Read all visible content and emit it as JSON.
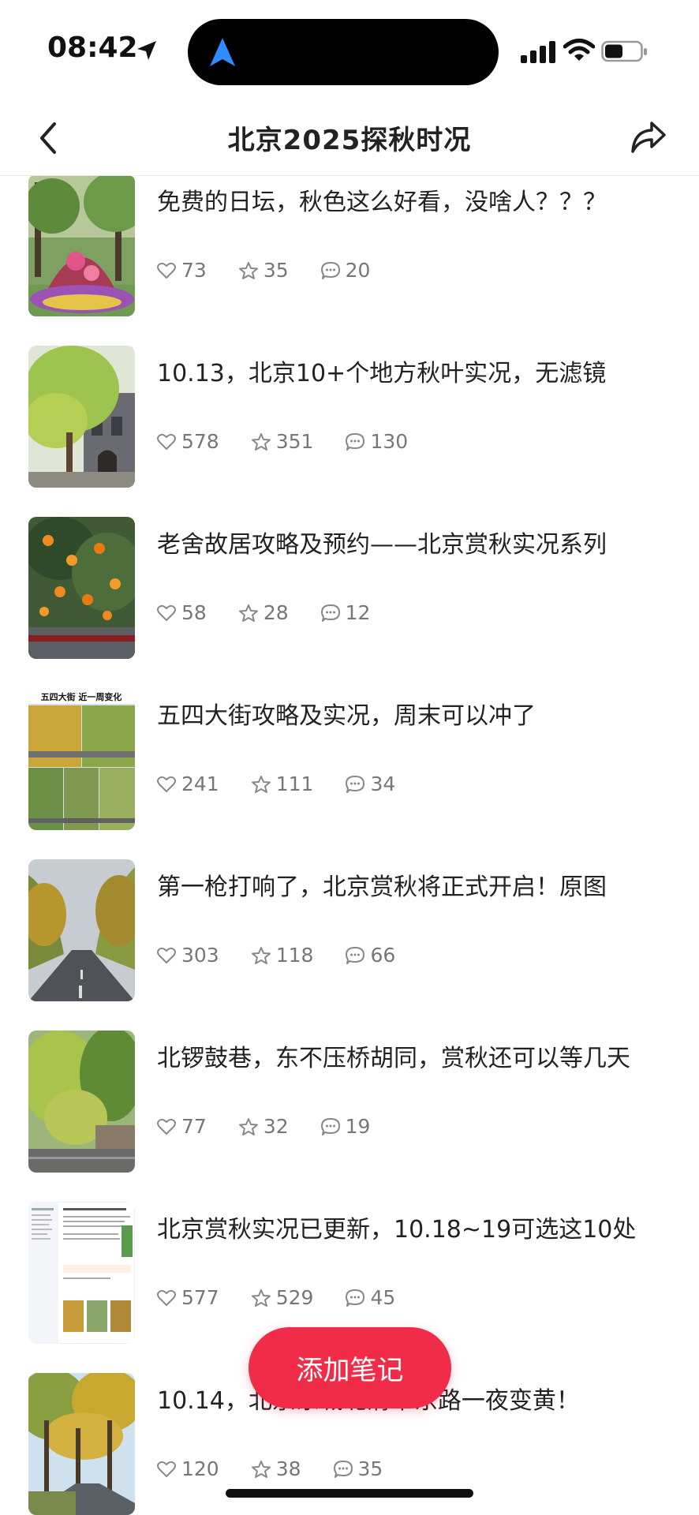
{
  "status_bar": {
    "time": "08:42"
  },
  "header": {
    "title": "北京2025探秋时况"
  },
  "posts": [
    {
      "title": "免费的日坛，秋色这么好看，没啥人？？？",
      "likes": "73",
      "stars": "35",
      "comments": "20"
    },
    {
      "title": "10.13，北京10+个地方秋叶实况，无滤镜",
      "likes": "578",
      "stars": "351",
      "comments": "130"
    },
    {
      "title": "老舍故居攻略及预约——北京赏秋实况系列",
      "likes": "58",
      "stars": "28",
      "comments": "12"
    },
    {
      "title": "五四大街攻略及实况，周末可以冲了",
      "likes": "241",
      "stars": "111",
      "comments": "34",
      "thumb_caption": "五四大街 近一周变化"
    },
    {
      "title": "第一枪打响了，北京赏秋将正式开启！原图",
      "likes": "303",
      "stars": "118",
      "comments": "66"
    },
    {
      "title": "北锣鼓巷，东不压桥胡同，赏秋还可以等几天",
      "likes": "77",
      "stars": "32",
      "comments": "19"
    },
    {
      "title": "北京赏秋实况已更新，10.18~19可选这10处",
      "likes": "577",
      "stars": "529",
      "comments": "45"
    },
    {
      "title": "10.14，北京东城北清华东路一夜变黄！",
      "likes": "120",
      "stars": "38",
      "comments": "35"
    }
  ],
  "add_note_button": {
    "label": "添加笔记"
  },
  "colors": {
    "accent": "#f12c48",
    "text": "#222222",
    "muted": "#777777"
  },
  "icons": {
    "back": "chevron-left-icon",
    "share": "share-icon",
    "like": "heart-icon",
    "star": "star-icon",
    "comment": "comment-icon"
  }
}
